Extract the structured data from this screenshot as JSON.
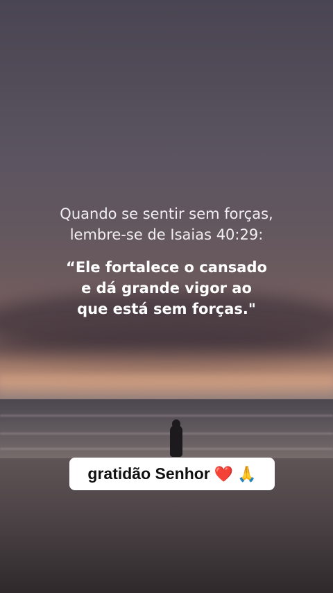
{
  "quote": {
    "intro_lines": [
      "Quando se sentir sem forças,",
      "lembre-se de Isaias 40:29:"
    ],
    "verse_lines": [
      "“Ele fortalece o cansado",
      "e dá grande vigor ao",
      "que está sem forças.\""
    ]
  },
  "caption": {
    "text": "gratidão Senhor",
    "emoji_1": "❤️",
    "emoji_2": "🙏"
  },
  "colors": {
    "caption_background": "#ffffff",
    "caption_text": "#111111",
    "heart": "#e0191f"
  },
  "icons": [
    "heart-emoji",
    "praying-hands-emoji"
  ]
}
